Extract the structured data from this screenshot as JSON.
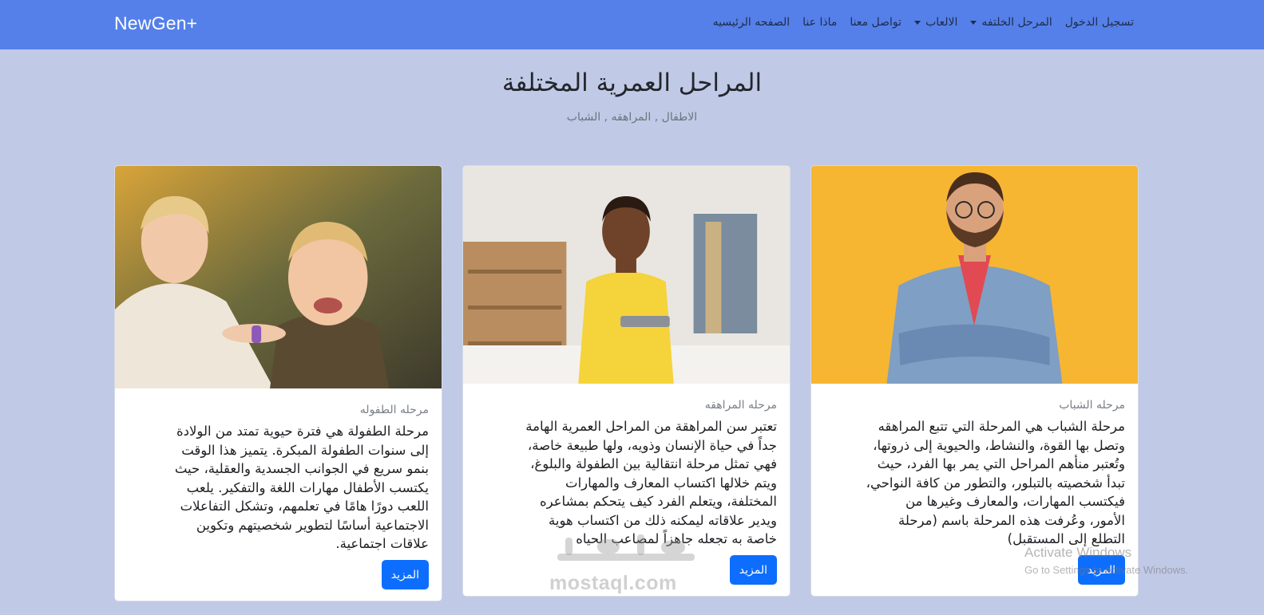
{
  "brand": "NewGen+",
  "nav": {
    "items": [
      {
        "label": "تسجيل الدخول",
        "dropdown": false
      },
      {
        "label": "المرحل الخلتفه",
        "dropdown": true
      },
      {
        "label": "الالعاب",
        "dropdown": true
      },
      {
        "label": "تواصل معنا",
        "dropdown": false
      },
      {
        "label": "ماذا عنا",
        "dropdown": false
      },
      {
        "label": "الصفحه الرئيسيه",
        "dropdown": false
      }
    ]
  },
  "hero": {
    "title": "المراحل العمرية المختلفة",
    "subtitle": "الاطفال , المراهقه , الشباب"
  },
  "cards": [
    {
      "subtitle": "مرحله الشباب",
      "lines": [
        "مرحلة الشباب هي المرحلة التي تتبع المراهقه",
        "وتصل بها القوة، والنشاط، والحيوية إلى ذروتها،",
        "وتُعتبر منأهم المراحل التي يمر بها الفرد، حيث",
        "تبدأ شخصيته بالتبلور، والتطور من كافة النواحي،",
        "فيكتسب المهارات، والمعارف وغيرها من",
        "الأمور، وعُرفت هذه المرحلة باسم (مرحلة",
        "التطلع إلى المستقبل)"
      ],
      "button": "المزيد"
    },
    {
      "subtitle": "مرحله المراهقه",
      "lines": [
        "تعتبر سن المراهقة من المراحل العمرية الهامة",
        "جداً في حياة الإنسان وذويه، ولها طبيعة خاصة،",
        "فهي تمثل مرحلة انتقالية بين الطفولة والبلوغ،",
        "ويتم خلالها اكتساب المعارف والمهارات",
        "المختلفة، ويتعلم الفرد كيف يتحكم بمشاعره",
        "ويدير علاقاته ليمكنه ذلك من اكتساب هوية",
        "خاصة به تجعله جاهزاً لمصاعب الحياه"
      ],
      "button": "المزيد"
    },
    {
      "subtitle": "مرحله الطفوله",
      "lines": [
        "مرحلة الطفولة هي فترة حيوية تمتد من الولادة",
        "إلى سنوات الطفولة المبكرة. يتميز هذا الوقت",
        "بنمو سريع في الجوانب الجسدية والعقلية، حيث",
        "يكتسب الأطفال مهارات اللغة والتفكير. يلعب",
        "اللعب دورًا هامًا في تعلمهم، وتشكل التفاعلات",
        "الاجتماعية أساسًا لتطوير شخصيتهم وتكوين",
        "علاقات اجتماعية."
      ],
      "button": "المزيد"
    }
  ],
  "overlay": {
    "activate_title": "Activate Windows",
    "activate_sub": "Go to Settings to activate Windows.",
    "watermark_logo": "مستقل",
    "watermark_site": "mostaql.com"
  },
  "colors": {
    "navbar": "#5580e9",
    "page_bg": "#c0c9e6",
    "button": "#0d6efd"
  }
}
